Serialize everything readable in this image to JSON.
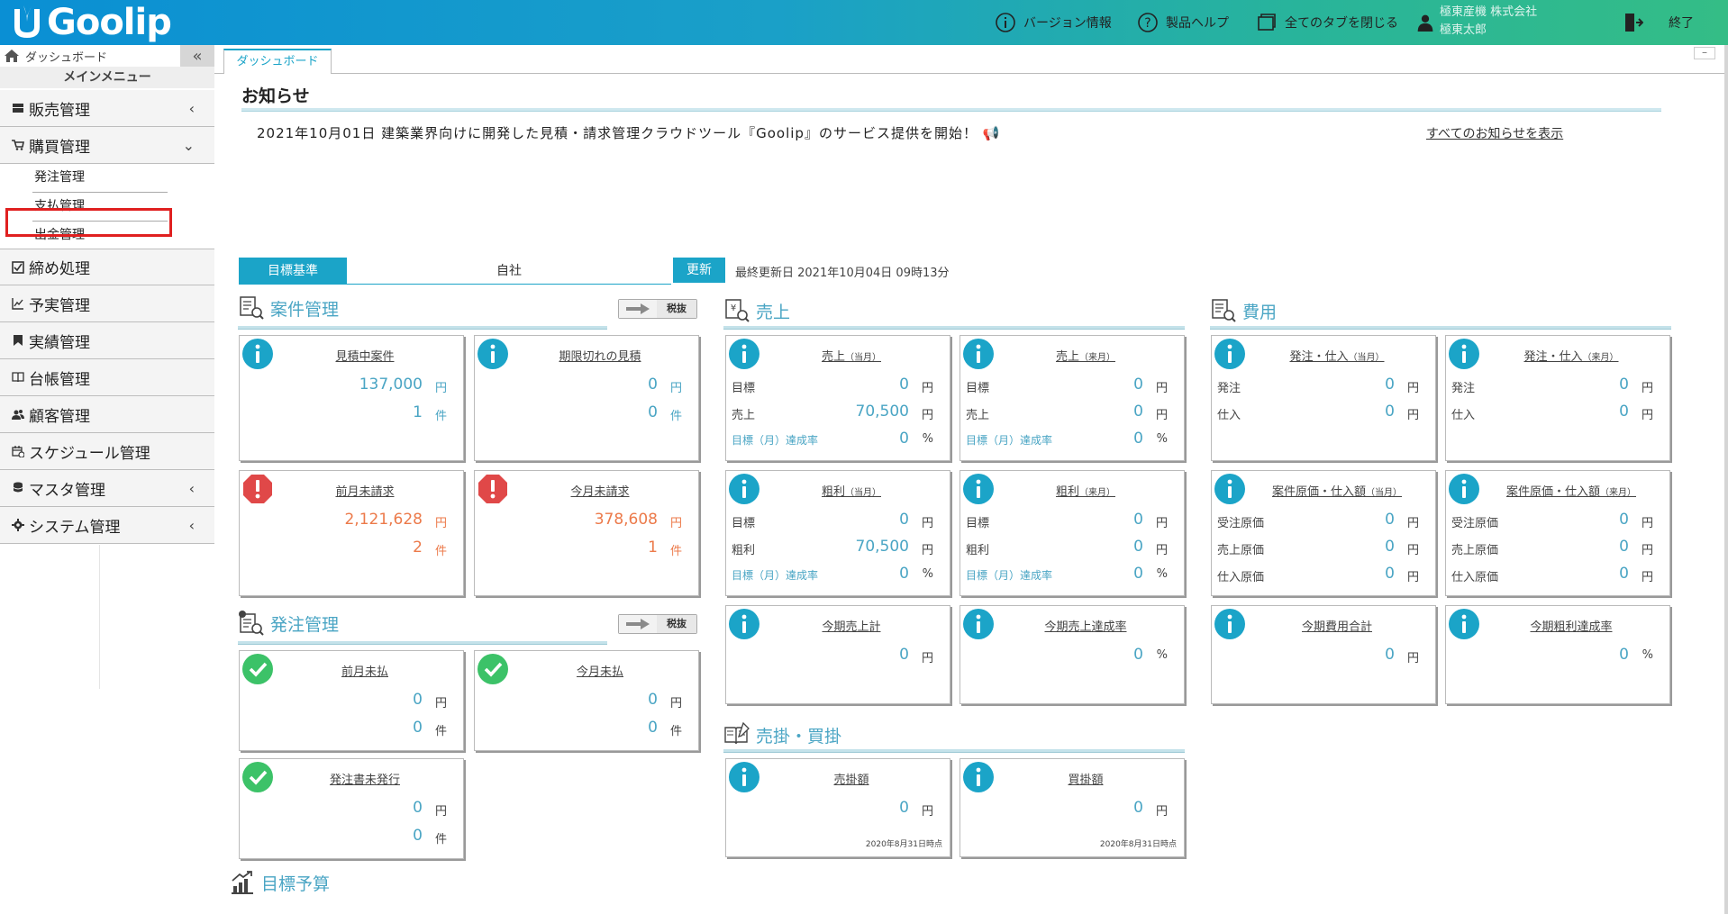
{
  "header": {
    "logo_text": "Goolip",
    "nav": {
      "version": "バージョン情報",
      "help": "製品ヘルプ",
      "close_tabs": "全てのタブを閉じる",
      "exit": "終了"
    },
    "company_name": "極東産機 株式会社",
    "user_name": "極東太郎"
  },
  "sidebar": {
    "dashboard": "ダッシュボード",
    "collapse": "«",
    "main_menu": "メインメニュー",
    "items": {
      "sales": "販売管理",
      "purchase": "購買管理",
      "closing": "締め処理",
      "budget": "予実管理",
      "results": "実績管理",
      "ledger": "台帳管理",
      "customer": "顧客管理",
      "schedule": "スケジュール管理",
      "master": "マスタ管理",
      "system": "システム管理"
    },
    "sub_items": {
      "order": "発注管理",
      "payment": "支払管理",
      "withdrawal": "出金管理"
    }
  },
  "tabs": {
    "active": "ダッシュボード",
    "minimize": "–"
  },
  "notice": {
    "title": "お知らせ",
    "text": "2021年10月01日 建築業界向けに開発した見積・請求管理クラウドツール『Goolip』のサービス提供を開始！ 📢",
    "link": "すべてのお知らせを表示"
  },
  "target": {
    "label": "目標基準",
    "value": "自社",
    "refresh": "更新",
    "last_update": "最終更新日 2021年10月04日 09時13分"
  },
  "common": {
    "tax_label": "税抜",
    "yen": "円",
    "count": "件",
    "percent": "%",
    "month_now": "（当月）",
    "month_next": "（来月）"
  },
  "colors": {
    "accent": "#1ba4c8",
    "value_blue": "#4aa5c4",
    "warning_red": "#e04848",
    "ok_green": "#3cc268",
    "value_orange": "#ec7a4a"
  },
  "sections": {
    "project": "案件管理",
    "order": "発注管理",
    "sales": "売上",
    "cost": "費用",
    "ar_ap": "売掛・買掛",
    "budget": "目標予算"
  },
  "cards": {
    "estimating": {
      "title": "見積中案件",
      "amount": "137,000",
      "count": "1"
    },
    "expired": {
      "title": "期限切れの見積",
      "amount": "0",
      "count": "0"
    },
    "last_unbilled": {
      "title": "前月未請求",
      "amount": "2,121,628",
      "count": "2"
    },
    "this_unbilled": {
      "title": "今月未請求",
      "amount": "378,608",
      "count": "1"
    },
    "last_unpaid": {
      "title": "前月未払",
      "amount": "0",
      "count": "0"
    },
    "this_unpaid": {
      "title": "今月未払",
      "amount": "0",
      "count": "0"
    },
    "po_unissued": {
      "title": "発注書未発行",
      "amount": "0",
      "count": "0"
    },
    "sales_now": {
      "title": "売上",
      "target_label": "目標",
      "target": "0",
      "actual_label": "売上",
      "actual": "70,500",
      "rate_label": "目標（月）達成率",
      "rate": "0"
    },
    "sales_next": {
      "title": "売上",
      "target_label": "目標",
      "target": "0",
      "actual_label": "売上",
      "actual": "0",
      "rate_label": "目標（月）達成率",
      "rate": "0"
    },
    "gross_now": {
      "title": "粗利",
      "target_label": "目標",
      "target": "0",
      "actual_label": "粗利",
      "actual": "70,500",
      "rate_label": "目標（月）達成率",
      "rate": "0"
    },
    "gross_next": {
      "title": "粗利",
      "target_label": "目標",
      "target": "0",
      "actual_label": "粗利",
      "actual": "0",
      "rate_label": "目標（月）達成率",
      "rate": "0"
    },
    "term_sales": {
      "title": "今期売上計",
      "value": "0"
    },
    "term_sales_rate": {
      "title": "今期売上達成率",
      "value": "0"
    },
    "order_purchase_now": {
      "title": "発注・仕入",
      "order_label": "発注",
      "order": "0",
      "purchase_label": "仕入",
      "purchase": "0"
    },
    "order_purchase_next": {
      "title": "発注・仕入",
      "order_label": "発注",
      "order": "0",
      "purchase_label": "仕入",
      "purchase": "0"
    },
    "cost_now": {
      "title": "案件原価・仕入額",
      "r1_label": "受注原価",
      "r1": "0",
      "r2_label": "売上原価",
      "r2": "0",
      "r3_label": "仕入原価",
      "r3": "0"
    },
    "cost_next": {
      "title": "案件原価・仕入額",
      "r1_label": "受注原価",
      "r1": "0",
      "r2_label": "売上原価",
      "r2": "0",
      "r3_label": "仕入原価",
      "r3": "0"
    },
    "term_cost": {
      "title": "今期費用合計",
      "value": "0"
    },
    "term_gross_rate": {
      "title": "今期粗利達成率",
      "value": "0"
    },
    "receivable": {
      "title": "売掛額",
      "value": "0",
      "as_of": "2020年8月31日時点"
    },
    "payable": {
      "title": "買掛額",
      "value": "0",
      "as_of": "2020年8月31日時点"
    }
  }
}
